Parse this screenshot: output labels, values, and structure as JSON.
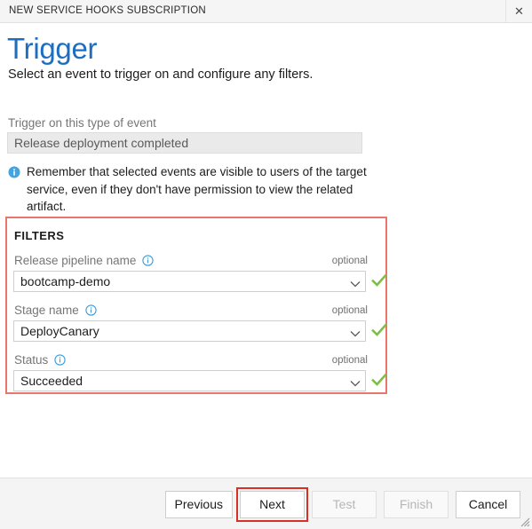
{
  "window": {
    "title": "NEW SERVICE HOOKS SUBSCRIPTION",
    "close_label": "✕"
  },
  "header": {
    "title": "Trigger",
    "subtitle": "Select an event to trigger on and configure any filters.",
    "title_color": "#1d6ec1"
  },
  "event": {
    "label": "Trigger on this type of event",
    "value": "Release deployment completed"
  },
  "note": {
    "icon": "info-icon",
    "text": "Remember that selected events are visible to users of the target service, even if they don't have permission to view the related artifact."
  },
  "filters": {
    "title": "FILTERS",
    "border_color": "#e8766a",
    "optional_label": "optional",
    "rows": [
      {
        "label": "Release pipeline name",
        "value": "bootcamp-demo",
        "optional": "optional",
        "valid": true
      },
      {
        "label": "Stage name",
        "value": "DeployCanary",
        "optional": "optional",
        "valid": true
      },
      {
        "label": "Status",
        "value": "Succeeded",
        "optional": "optional",
        "valid": true
      }
    ]
  },
  "footer": {
    "buttons": [
      {
        "label": "Previous",
        "disabled": false,
        "highlighted": false
      },
      {
        "label": "Next",
        "disabled": false,
        "highlighted": true
      },
      {
        "label": "Test",
        "disabled": true,
        "highlighted": false
      },
      {
        "label": "Finish",
        "disabled": true,
        "highlighted": false
      },
      {
        "label": "Cancel",
        "disabled": false,
        "highlighted": false
      }
    ],
    "highlight_color": "#d93025"
  }
}
